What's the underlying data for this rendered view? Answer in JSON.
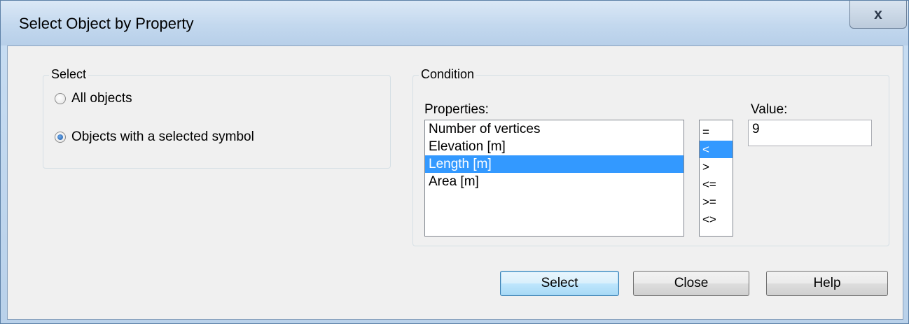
{
  "window": {
    "title": "Select Object by Property",
    "close_glyph": "x"
  },
  "select_group": {
    "legend": "Select",
    "options": [
      {
        "label": "All objects",
        "checked": false
      },
      {
        "label": "Objects with a selected symbol",
        "checked": true
      }
    ]
  },
  "condition_group": {
    "legend": "Condition",
    "properties_label": "Properties:",
    "properties": [
      "Number of vertices",
      "Elevation [m]",
      "Length [m]",
      "Area [m]"
    ],
    "selected_property_index": 2,
    "operators": [
      "=",
      "<",
      ">",
      "<=",
      ">=",
      "<>"
    ],
    "selected_operator_index": 1,
    "value_label": "Value:",
    "value": "9"
  },
  "buttons": {
    "select": "Select",
    "close": "Close",
    "help": "Help"
  },
  "colors": {
    "selection": "#3399ff",
    "frame": "#b9d1ea"
  }
}
